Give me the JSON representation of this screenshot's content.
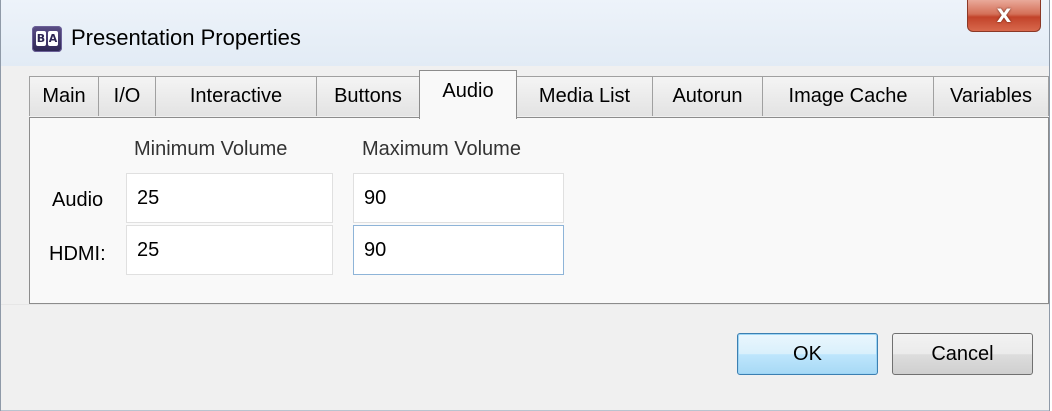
{
  "window": {
    "title": "Presentation Properties",
    "icon_letters": [
      "B",
      "A"
    ],
    "close_symbol": "X",
    "accent_close": "#c2432a"
  },
  "tabs": [
    {
      "label": "Main"
    },
    {
      "label": "I/O"
    },
    {
      "label": "Interactive"
    },
    {
      "label": "Buttons"
    },
    {
      "label": "Audio",
      "selected": true
    },
    {
      "label": "Media List"
    },
    {
      "label": "Autorun"
    },
    {
      "label": "Image Cache"
    },
    {
      "label": "Variables"
    }
  ],
  "audio": {
    "min_header": "Minimum Volume",
    "max_header": "Maximum Volume",
    "rows": [
      {
        "label": "Audio",
        "min": "25",
        "max": "90"
      },
      {
        "label": "HDMI:",
        "min": "25",
        "max": "90"
      }
    ]
  },
  "buttons": {
    "ok": "OK",
    "cancel": "Cancel"
  },
  "colors": {
    "ok_border": "#3c7fb1",
    "focused_field_border": "#8eb4d8"
  }
}
